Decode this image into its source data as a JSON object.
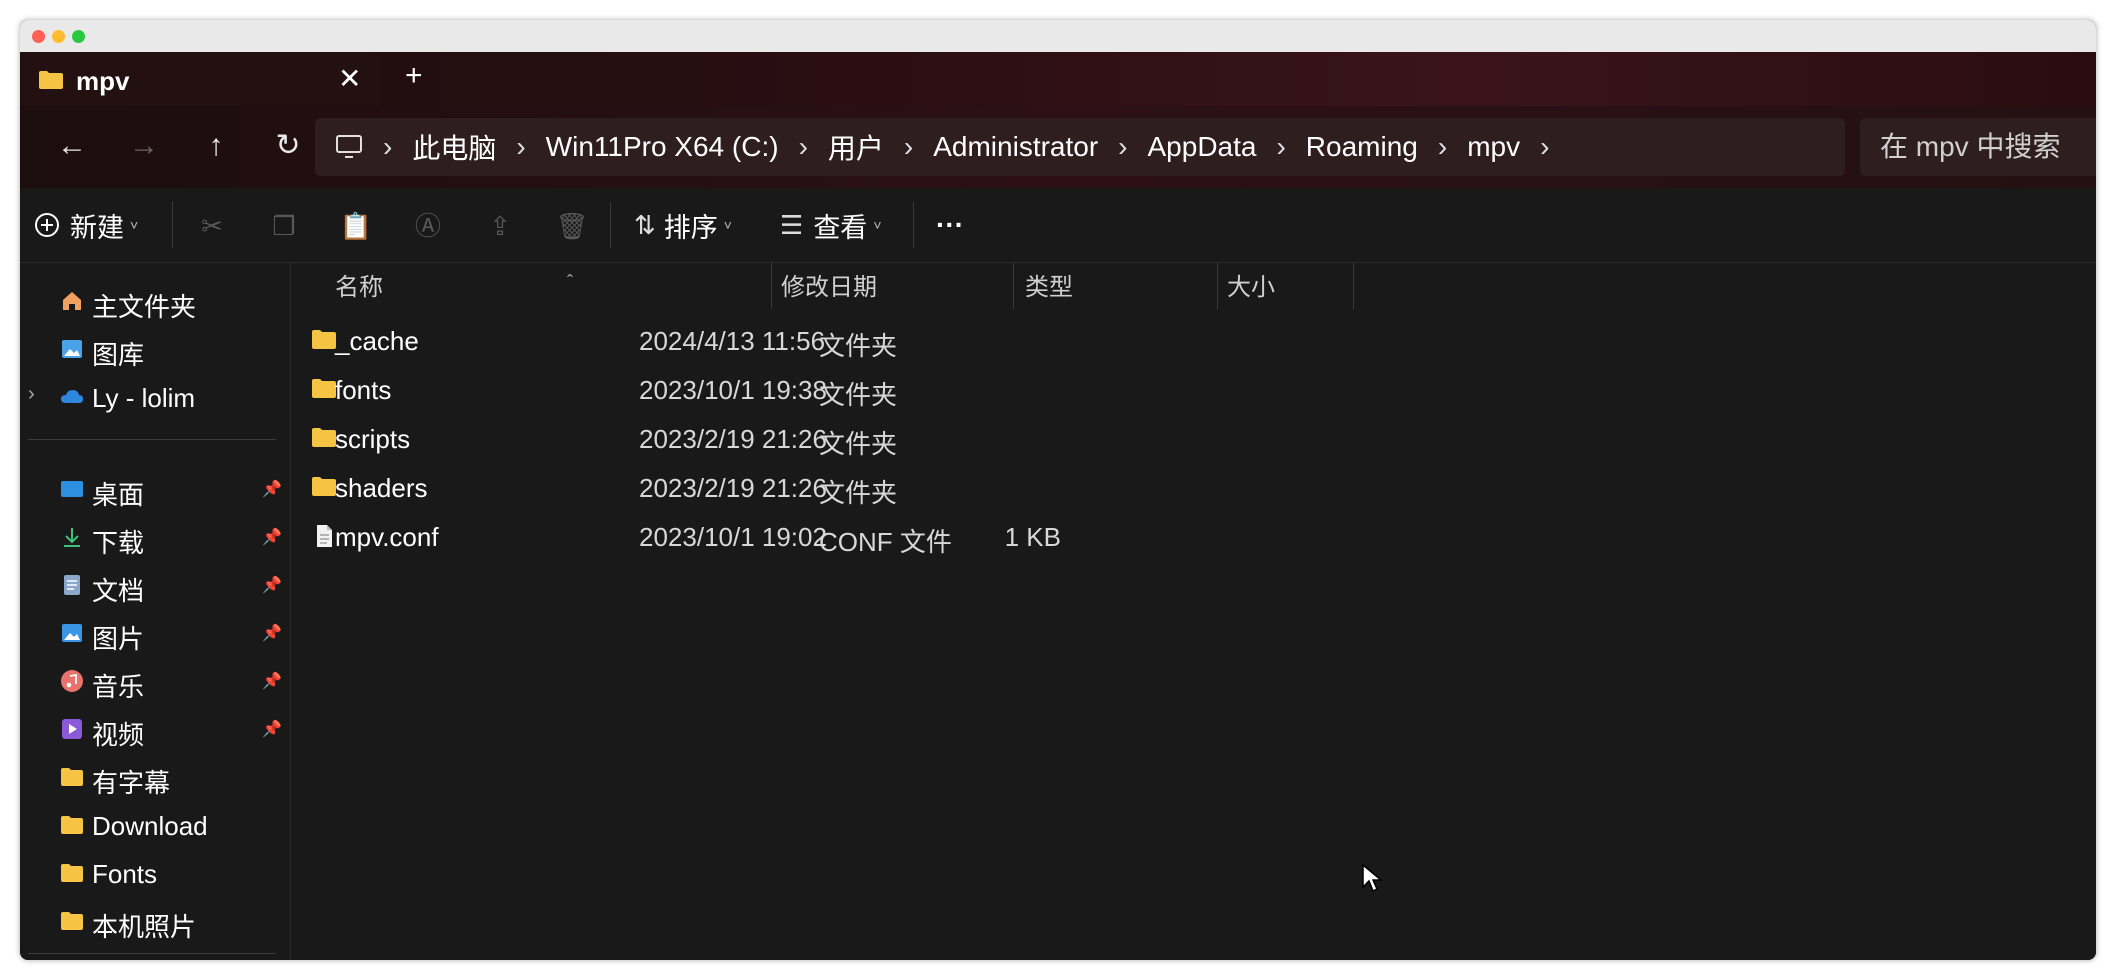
{
  "tab": {
    "title": "mpv",
    "close": "✕",
    "new_tab": "+"
  },
  "nav": {
    "back": "←",
    "forward": "→",
    "up": "↑",
    "refresh": "↻"
  },
  "breadcrumb": [
    "此电脑",
    "Win11Pro X64 (C:)",
    "用户",
    "Administrator",
    "AppData",
    "Roaming",
    "mpv"
  ],
  "breadcrumb_sep": "›",
  "search": {
    "placeholder": "在 mpv 中搜索"
  },
  "toolbar": {
    "new_label": "新建",
    "sort_label": "排序",
    "view_label": "查看",
    "more_label": "···"
  },
  "sidebar": {
    "top_items": [
      {
        "label": "主文件夹",
        "icon": "home-icon"
      },
      {
        "label": "图库",
        "icon": "gallery-icon"
      },
      {
        "label": "Ly - lolim",
        "icon": "cloud-icon"
      }
    ],
    "pinned_items": [
      {
        "label": "桌面",
        "icon": "desktop-icon"
      },
      {
        "label": "下载",
        "icon": "download-icon"
      },
      {
        "label": "文档",
        "icon": "document-icon"
      },
      {
        "label": "图片",
        "icon": "pictures-icon"
      },
      {
        "label": "音乐",
        "icon": "music-icon"
      },
      {
        "label": "视频",
        "icon": "video-icon"
      }
    ],
    "folders": [
      {
        "label": "有字幕",
        "icon": "folder-icon"
      },
      {
        "label": "Download",
        "icon": "folder-icon"
      },
      {
        "label": "Fonts",
        "icon": "folder-icon"
      },
      {
        "label": "本机照片",
        "icon": "folder-icon"
      }
    ]
  },
  "columns": {
    "name": "名称",
    "date": "修改日期",
    "type": "类型",
    "size": "大小"
  },
  "files": [
    {
      "name": "_cache",
      "date": "2024/4/13 11:56",
      "type": "文件夹",
      "size": "",
      "icon": "folder-icon"
    },
    {
      "name": "fonts",
      "date": "2023/10/1 19:38",
      "type": "文件夹",
      "size": "",
      "icon": "folder-icon"
    },
    {
      "name": "scripts",
      "date": "2023/2/19 21:26",
      "type": "文件夹",
      "size": "",
      "icon": "folder-icon"
    },
    {
      "name": "shaders",
      "date": "2023/2/19 21:26",
      "type": "文件夹",
      "size": "",
      "icon": "folder-icon"
    },
    {
      "name": "mpv.conf",
      "date": "2023/10/1 19:02",
      "type": "CONF 文件",
      "size": "1 KB",
      "icon": "file-icon"
    }
  ],
  "colors": {
    "folder": "#f5c443",
    "window_bg": "#191919",
    "accent_tab": "#2a0e12"
  }
}
